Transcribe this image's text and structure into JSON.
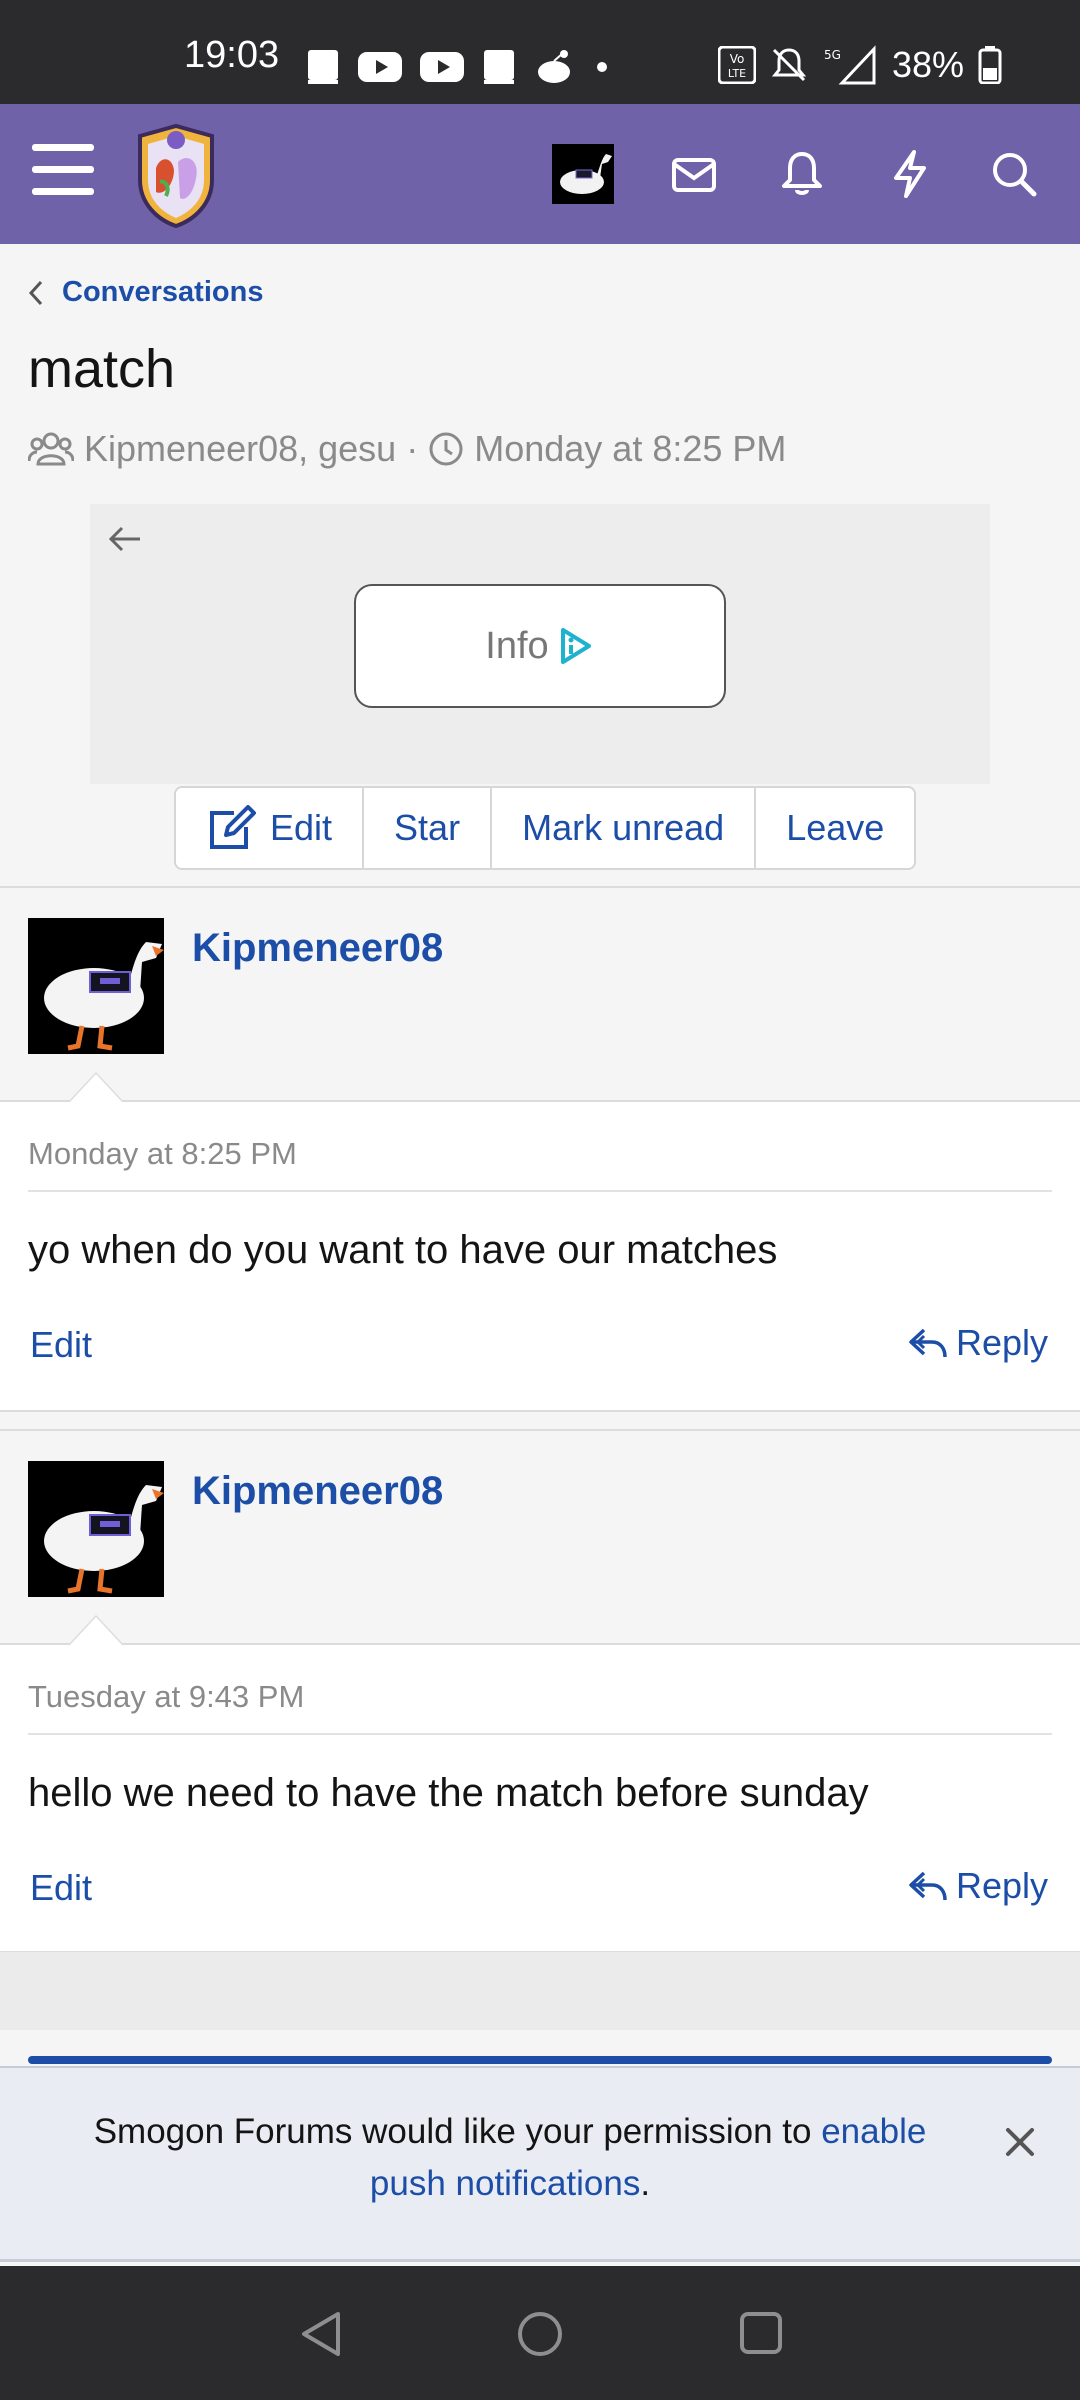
{
  "status_bar": {
    "time": "19:03",
    "battery": "38%",
    "left_icons": [
      "book-icon",
      "youtube-icon",
      "youtube-icon",
      "book-icon",
      "reddit-icon",
      "dot-icon"
    ],
    "right_icons": [
      "volte-icon",
      "mute-icon",
      "5g-signal-icon",
      "battery-icon"
    ]
  },
  "header": {
    "icons": [
      "menu-icon",
      "logo-icon",
      "avatar",
      "mail-icon",
      "bell-icon",
      "bolt-icon",
      "search-icon"
    ]
  },
  "breadcrumb": {
    "label": "Conversations"
  },
  "conversation": {
    "title": "match",
    "participants": "Kipmeneer08, gesu",
    "separator": "·",
    "started": "Monday at 8:25 PM"
  },
  "ad": {
    "button_label": "Info"
  },
  "actions": {
    "edit": "Edit",
    "star": "Star",
    "mark_unread": "Mark unread",
    "leave": "Leave"
  },
  "messages": [
    {
      "username": "Kipmeneer08",
      "date": "Monday at 8:25 PM",
      "body": "yo when do you want to have our matches",
      "edit_label": "Edit",
      "reply_label": "Reply"
    },
    {
      "username": "Kipmeneer08",
      "date": "Tuesday at 9:43 PM",
      "body": "hello we need to have the match before sunday",
      "edit_label": "Edit",
      "reply_label": "Reply"
    }
  ],
  "push_banner": {
    "text": "Smogon Forums would like your permission to ",
    "link": "enable push notifications",
    "suffix": "."
  },
  "colors": {
    "header": "#6f62a8",
    "link": "#1c4ea8",
    "status_bar": "#2b2b2d"
  }
}
